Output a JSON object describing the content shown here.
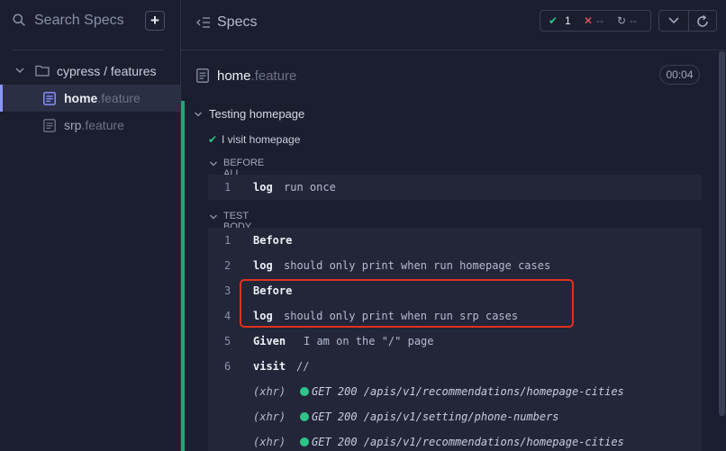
{
  "sidebar": {
    "search_placeholder": "Search Specs",
    "add_label": "+",
    "folder_label": "cypress / features",
    "specs": [
      {
        "name": "home",
        "ext": ".feature",
        "active": true
      },
      {
        "name": "srp",
        "ext": ".feature",
        "active": false
      }
    ]
  },
  "topbar": {
    "title": "Specs",
    "stats": {
      "pass_icon": "✔",
      "passed": "1",
      "fail_icon": "✕",
      "failed": "--",
      "pending_icon": "↻",
      "pending": "--"
    }
  },
  "file": {
    "name": "home",
    "ext": ".feature",
    "duration": "00:04"
  },
  "suite": {
    "title": "Testing homepage",
    "test_check": "✔",
    "test_title": "I visit homepage",
    "before_all": {
      "label": "BEFORE ALL",
      "commands": [
        {
          "num": "1",
          "name": "log",
          "message": "run once"
        }
      ]
    },
    "test_body": {
      "label": "TEST BODY",
      "commands": [
        {
          "num": "1",
          "name": "Before",
          "message": ""
        },
        {
          "num": "2",
          "name": "log",
          "message": "should only print when run homepage cases"
        },
        {
          "num": "3",
          "name": "Before",
          "message": ""
        },
        {
          "num": "4",
          "name": "log",
          "message": "should only print when run srp cases"
        },
        {
          "num": "5",
          "name": "Given",
          "message": "I am on the \"/\" page"
        },
        {
          "num": "6",
          "name": "visit",
          "message": "//"
        }
      ],
      "xhr": [
        {
          "label": "(xhr)",
          "message": "GET 200 /apis/v1/recommendations/homepage-cities"
        },
        {
          "label": "(xhr)",
          "message": "GET 200 /apis/v1/setting/phone-numbers"
        },
        {
          "label": "(xhr)",
          "message": "GET 200 /apis/v1/recommendations/homepage-cities"
        }
      ]
    }
  },
  "colors": {
    "pass": "#2fc48a",
    "fail": "#ff5a6a",
    "accent": "#8e94ff",
    "highlight": "#e0321e"
  },
  "icons": [
    "search-icon",
    "plus-icon",
    "chevron-down-icon",
    "folder-icon",
    "document-icon",
    "collapse-list-icon",
    "refresh-icon"
  ]
}
